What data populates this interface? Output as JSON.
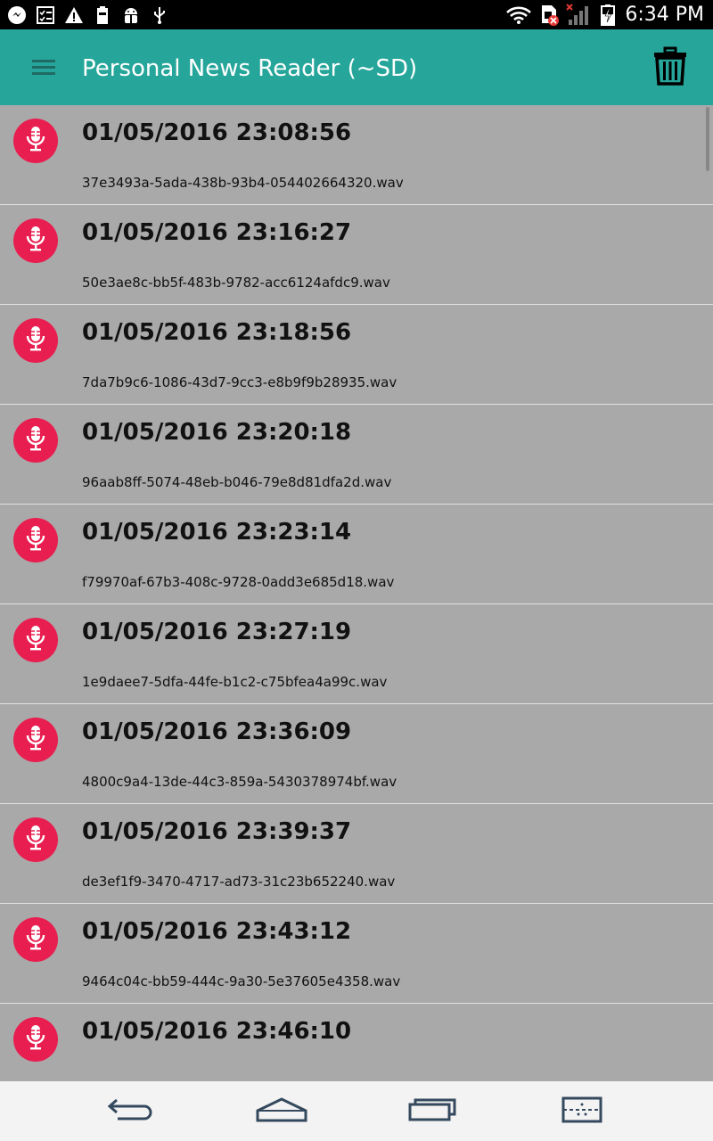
{
  "status_bar": {
    "time": "6:34 PM",
    "left_icons": [
      "messenger-icon",
      "screen-checklist-icon",
      "warning-icon",
      "battery-100-icon",
      "android-debug-icon",
      "usb-icon"
    ],
    "right_icons": [
      "wifi-icon",
      "sim-error-icon",
      "cell-signal-icon",
      "battery-charging-icon"
    ]
  },
  "app_bar": {
    "title": "Personal News Reader (~SD)",
    "menu_icon": "hamburger-menu-icon",
    "action_icon": "trash-icon"
  },
  "recordings": [
    {
      "timestamp": "01/05/2016 23:08:56",
      "filename": "37e3493a-5ada-438b-93b4-054402664320.wav"
    },
    {
      "timestamp": "01/05/2016 23:16:27",
      "filename": "50e3ae8c-bb5f-483b-9782-acc6124afdc9.wav"
    },
    {
      "timestamp": "01/05/2016 23:18:56",
      "filename": "7da7b9c6-1086-43d7-9cc3-e8b9f9b28935.wav"
    },
    {
      "timestamp": "01/05/2016 23:20:18",
      "filename": "96aab8ff-5074-48eb-b046-79e8d81dfa2d.wav"
    },
    {
      "timestamp": "01/05/2016 23:23:14",
      "filename": "f79970af-67b3-408c-9728-0add3e685d18.wav"
    },
    {
      "timestamp": "01/05/2016 23:27:19",
      "filename": "1e9daee7-5dfa-44fe-b1c2-c75bfea4a99c.wav"
    },
    {
      "timestamp": "01/05/2016 23:36:09",
      "filename": "4800c9a4-13de-44c3-859a-5430378974bf.wav"
    },
    {
      "timestamp": "01/05/2016 23:39:37",
      "filename": "de3ef1f9-3470-4717-ad73-31c23b652240.wav"
    },
    {
      "timestamp": "01/05/2016 23:43:12",
      "filename": "9464c04c-bb59-444c-9a30-5e37605e4358.wav"
    },
    {
      "timestamp": "01/05/2016 23:46:10",
      "filename": ""
    }
  ],
  "colors": {
    "app_bar": "#26a69a",
    "list_background": "#a9a9a9",
    "mic_badge": "#e91e50"
  },
  "nav_bar": {
    "icons": [
      "back-icon",
      "home-icon",
      "recent-apps-icon",
      "split-screen-icon"
    ]
  }
}
